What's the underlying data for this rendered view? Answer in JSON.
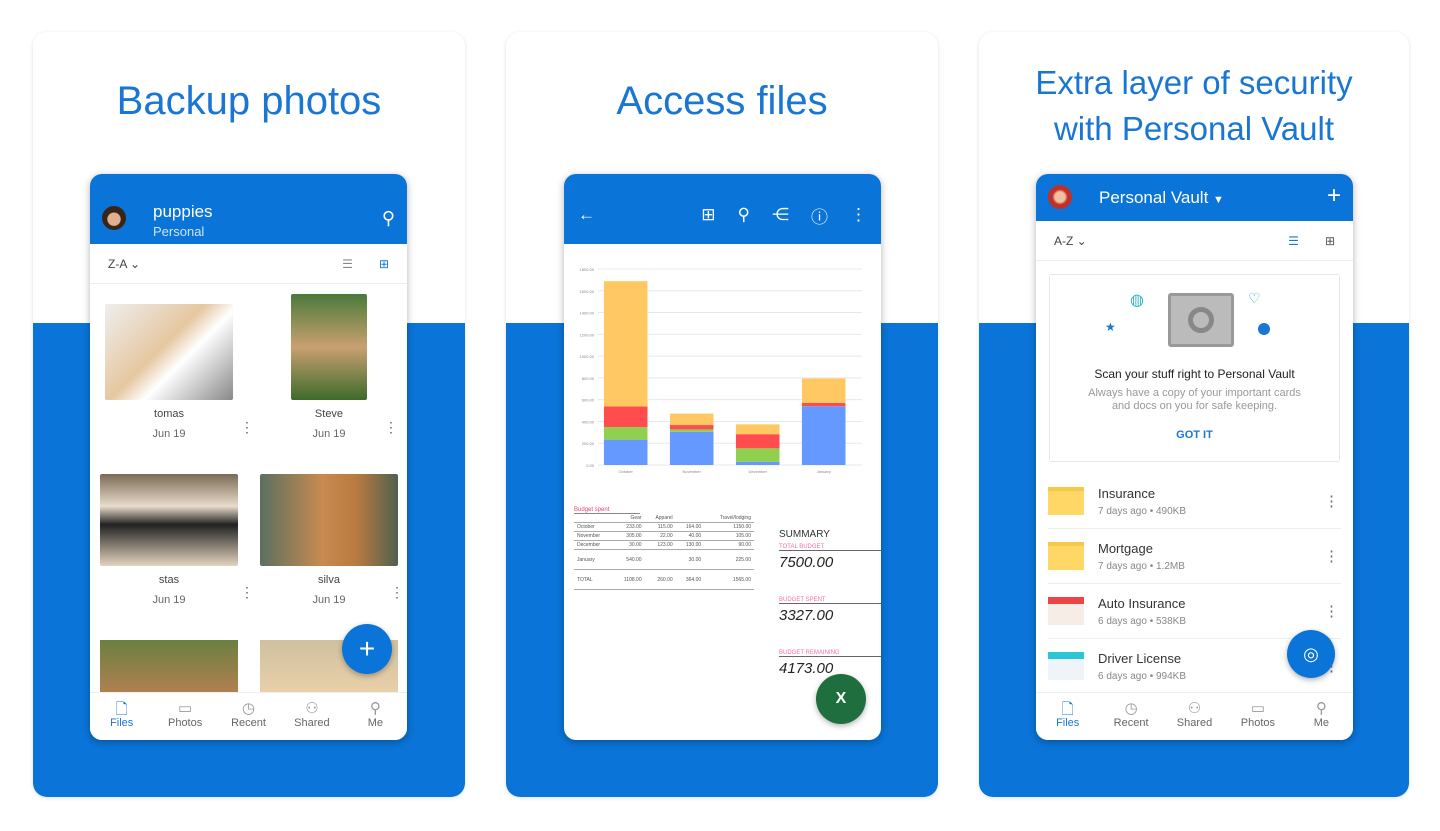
{
  "colors": {
    "accent": "#0a74d8",
    "headline": "#1976d2",
    "excel": "#1e6e3e"
  },
  "panels": [
    {
      "headline": "Backup photos",
      "app": {
        "folder": "puppies",
        "account": "Personal",
        "sort": "Z-A",
        "items": [
          {
            "name": "tomas",
            "date": "Jun 19"
          },
          {
            "name": "Steve",
            "date": "Jun 19"
          },
          {
            "name": "stas",
            "date": "Jun 19"
          },
          {
            "name": "silva",
            "date": "Jun 19"
          }
        ],
        "tabs": [
          "Files",
          "Photos",
          "Recent",
          "Shared",
          "Me"
        ],
        "active_tab": "Files"
      }
    },
    {
      "headline": "Access files",
      "app": {
        "icons": [
          "back-arrow-icon",
          "grid-icon",
          "search-icon",
          "share-icon",
          "info-icon",
          "more-icon"
        ],
        "table": {
          "title": "Budget spent",
          "headers": [
            "",
            "Gear",
            "Apparel",
            "",
            "Travel/lodging"
          ],
          "rows": [
            [
              "October",
              "233.00",
              "115.00",
              "164.00",
              "1150.00"
            ],
            [
              "November",
              "305.00",
              "22.00",
              "40.00",
              "105.00"
            ],
            [
              "December",
              "30.00",
              "123.00",
              "130.00",
              "90.00"
            ],
            [
              "January",
              "540.00",
              "",
              "30.00",
              "225.00"
            ],
            [
              "TOTAL",
              "1108.00",
              "260.00",
              "364.00",
              "1565.00"
            ]
          ]
        },
        "summary": {
          "title": "SUMMARY",
          "items": [
            {
              "label": "TOTAL BUDGET",
              "value": "7500.00"
            },
            {
              "label": "BUDGET SPENT",
              "value": "3327.00"
            },
            {
              "label": "BUDGET REMAINING",
              "value": "4173.00"
            }
          ]
        }
      }
    },
    {
      "headline_line1": "Extra layer of security",
      "headline_line2": "with Personal Vault",
      "app": {
        "title": "Personal Vault",
        "sort": "A-Z",
        "promo": {
          "title": "Scan your stuff right to Personal Vault",
          "body_line1": "Always have a copy of your important cards",
          "body_line2": "and docs on you for safe keeping.",
          "action": "GOT IT"
        },
        "files": [
          {
            "name": "Insurance",
            "meta": "7 days ago • 490KB",
            "type": "folder"
          },
          {
            "name": "Mortgage",
            "meta": "7 days ago • 1.2MB",
            "type": "folder"
          },
          {
            "name": "Auto Insurance",
            "meta": "6 days ago • 538KB",
            "type": "doc"
          },
          {
            "name": "Driver License",
            "meta": "6 days ago • 994KB",
            "type": "id"
          }
        ],
        "tabs": [
          "Files",
          "Recent",
          "Shared",
          "Photos",
          "Me"
        ],
        "active_tab": "Files"
      }
    }
  ],
  "chart_data": {
    "type": "bar",
    "stacked": true,
    "categories": [
      "October",
      "November",
      "December",
      "January"
    ],
    "yticks": [
      "0.00",
      "200.00",
      "400.00",
      "600.00",
      "800.00",
      "1000.00",
      "1200.00",
      "1400.00",
      "1600.00",
      "1800.00"
    ],
    "ylim": [
      0,
      1800
    ],
    "grid": true,
    "series": [
      {
        "color": "#6699ff",
        "values": [
          233,
          305,
          30,
          540
        ]
      },
      {
        "color": "#8fd14f",
        "values": [
          115,
          22,
          123,
          0
        ]
      },
      {
        "color": "#ff4d4d",
        "values": [
          190,
          40,
          130,
          30
        ]
      },
      {
        "color": "#ffc862",
        "values": [
          1150,
          105,
          90,
          225
        ]
      }
    ]
  }
}
